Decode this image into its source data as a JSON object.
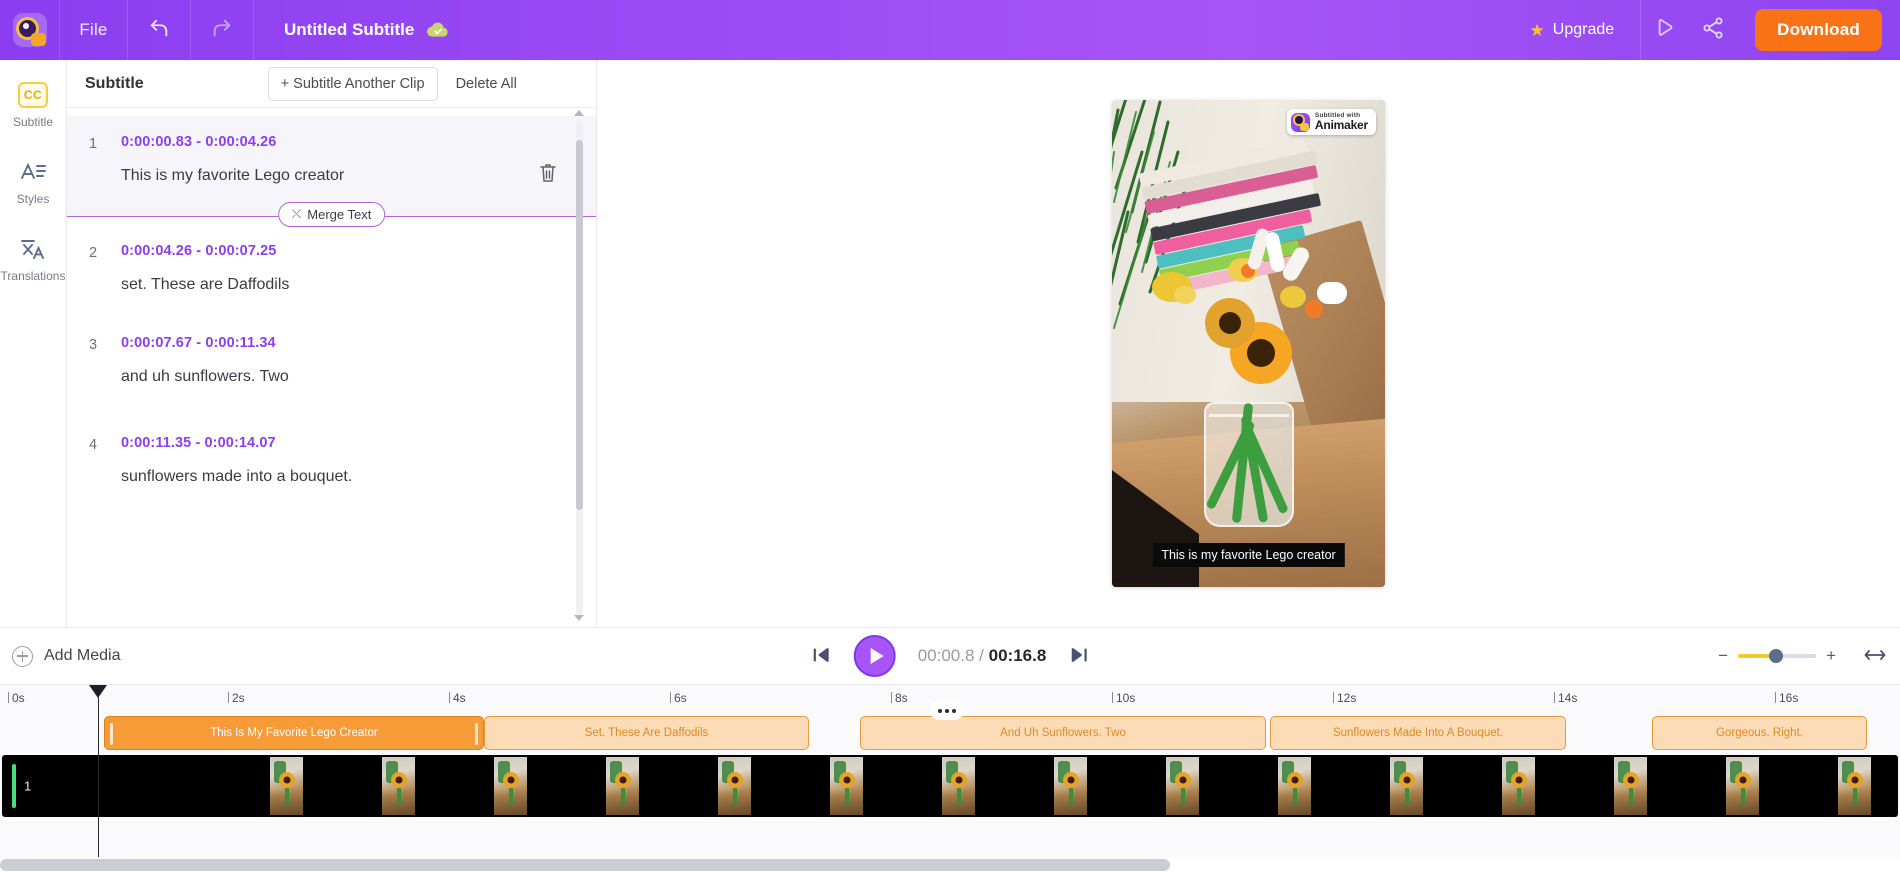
{
  "header": {
    "logo_icon": "animaker-logo-icon",
    "file_menu": "File",
    "undo_icon": "undo-icon",
    "redo_icon": "redo-icon",
    "project_title": "Untitled Subtitle",
    "saved_icon": "cloud-check-icon",
    "upgrade_label": "Upgrade",
    "upgrade_star": "★",
    "preview_icon": "preview-play-icon",
    "share_icon": "share-icon",
    "download_label": "Download",
    "accent_purple": "#a855f7",
    "download_orange": "#f97316"
  },
  "rail": {
    "items": [
      {
        "label": "Subtitle",
        "icon": "cc-icon",
        "badge": "CC",
        "active": true
      },
      {
        "label": "Styles",
        "icon": "text-styles-icon",
        "active": false
      },
      {
        "label": "Translations",
        "icon": "translate-icon",
        "active": false
      }
    ]
  },
  "subtitle_panel": {
    "title": "Subtitle",
    "add_clip_label": "+ Subtitle Another Clip",
    "delete_all_label": "Delete All",
    "merge_label": "Merge Text",
    "delete_icon": "trash-icon",
    "time_color": "#8b3ff0",
    "entries": [
      {
        "index": "1",
        "start": "0:00:00.83",
        "end": "0:00:04.26",
        "time": "0:00:00.83 - 0:00:04.26",
        "text": "This is my favorite Lego creator",
        "active": true
      },
      {
        "index": "2",
        "start": "0:00:04.26",
        "end": "0:00:07.25",
        "time": "0:00:04.26 - 0:00:07.25",
        "text": "set. These are Daffodils",
        "active": false
      },
      {
        "index": "3",
        "start": "0:00:07.67",
        "end": "0:00:11.34",
        "time": "0:00:07.67 - 0:00:11.34",
        "text": "and uh sunflowers. Two",
        "active": false
      },
      {
        "index": "4",
        "start": "0:00:11.35",
        "end": "0:00:14.07",
        "time": "0:00:11.35 - 0:00:14.07",
        "text": "sunflowers made into a bouquet.",
        "active": false
      }
    ]
  },
  "stage": {
    "watermark_sub": "Subtitled with",
    "watermark_name": "Animaker",
    "caption": "This is my favorite Lego creator"
  },
  "playbar": {
    "add_media_label": "Add Media",
    "prev_icon": "skip-previous-icon",
    "play_icon": "play-icon",
    "next_icon": "skip-next-icon",
    "current_time": "00:00.8",
    "separator": "/",
    "total_time": "00:16.8",
    "zoom_out": "−",
    "zoom_in": "+",
    "fit_icon": "fit-to-screen-icon"
  },
  "timeline": {
    "ticks": [
      "0s",
      "2s",
      "4s",
      "6s",
      "8s",
      "10s",
      "12s",
      "14s",
      "16s"
    ],
    "track_number": "1",
    "more_options_icon": "more-options-icon",
    "playhead_time": "00:00.8",
    "clips": [
      {
        "label": "This Is My Favorite Lego Creator",
        "start": 0.83,
        "end": 4.26,
        "selected": true
      },
      {
        "label": "Set. These Are Daffodils",
        "start": 4.26,
        "end": 7.25,
        "selected": false
      },
      {
        "label": "And Uh Sunflowers. Two",
        "start": 7.67,
        "end": 11.34,
        "selected": false
      },
      {
        "label": "Sunflowers Made Into A Bouquet.",
        "start": 11.35,
        "end": 14.07,
        "selected": false
      },
      {
        "label": "Gorgeous. Right.",
        "start": 14.95,
        "end": 17.0,
        "selected": false
      }
    ]
  }
}
